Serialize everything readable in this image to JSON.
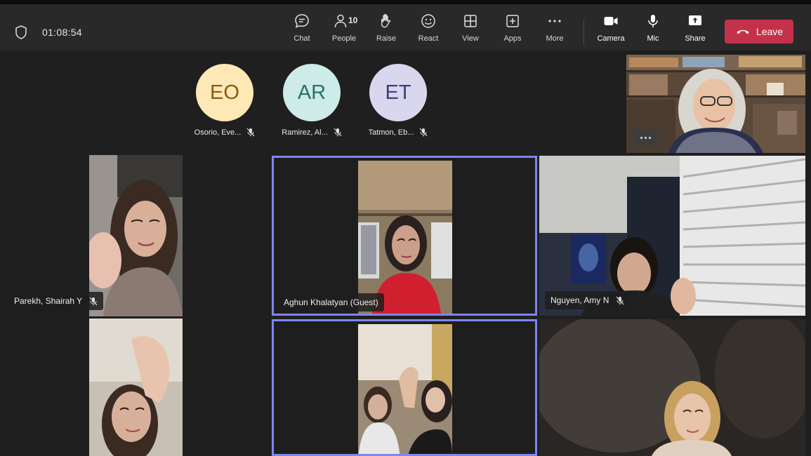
{
  "meeting": {
    "timer": "01:08:54"
  },
  "toolbar": {
    "chat": "Chat",
    "people": "People",
    "people_count": "10",
    "raise": "Raise",
    "react": "React",
    "view": "View",
    "apps": "Apps",
    "more": "More",
    "camera": "Camera",
    "mic": "Mic",
    "share": "Share",
    "leave": "Leave"
  },
  "colors": {
    "leave": "#c4314b",
    "active_border": "#7f85f5",
    "toolbar_bg": "#292929",
    "stage_bg": "#1f1f1f"
  },
  "avatars": [
    {
      "initials": "EO",
      "name": "Osorio, Eve...",
      "bg": "#fde8b6",
      "fg": "#8a5b10"
    },
    {
      "initials": "AR",
      "name": "Ramirez, Al...",
      "bg": "#cdebe8",
      "fg": "#2b6f6a"
    },
    {
      "initials": "ET",
      "name": "Tatmon, Eb...",
      "bg": "#d9d7ee",
      "fg": "#3f3d7a"
    }
  ],
  "tiles": [
    {
      "name": "Parekh, Shairah Y"
    },
    {
      "name": "Aghun Khalatyan (Guest)"
    },
    {
      "name": "Nguyen, Amy N"
    }
  ]
}
